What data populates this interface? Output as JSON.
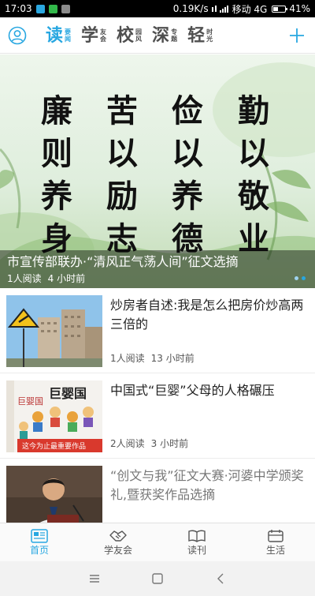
{
  "status_bar": {
    "time": "17:03",
    "network_speed": "0.19K/s",
    "carrier": "移动 4G",
    "battery": "41%"
  },
  "top_nav": {
    "tabs": [
      {
        "big": "读",
        "small": "要闻",
        "active": true
      },
      {
        "big": "学",
        "small": "友会",
        "active": false
      },
      {
        "big": "校",
        "small": "园风",
        "active": false
      },
      {
        "big": "深",
        "small": "专题",
        "active": false
      },
      {
        "big": "轻",
        "small": "时光",
        "active": false
      }
    ]
  },
  "banner": {
    "calligraphy_columns": [
      [
        "廉",
        "则",
        "养",
        "身"
      ],
      [
        "苦",
        "以",
        "励",
        "志"
      ],
      [
        "俭",
        "以",
        "养",
        "德"
      ],
      [
        "勤",
        "以",
        "敬",
        "业"
      ]
    ],
    "title": "市宣传部联办·“清风正气荡人间”征文选摘",
    "reads": "1人阅读",
    "time": "4 小时前",
    "slide_count": 2,
    "active_slide": 1
  },
  "feed": {
    "articles": [
      {
        "title": "炒房者自述:我是怎么把房价炒高两三倍的",
        "reads": "1人阅读",
        "time": "13 小时前"
      },
      {
        "title": "中国式“巨婴”父母的人格碾压",
        "reads": "2人阅读",
        "time": "3 小时前"
      },
      {
        "title": "“创文与我”征文大赛·河婆中学颁奖礼,暨获奖作品选摘",
        "reads": "",
        "time": ""
      }
    ],
    "thumb_texts": {
      "book_title": "巨婴国",
      "book_side": "巨婴国",
      "book_banner": "这今为止最重要作品"
    }
  },
  "tab_bar": {
    "tabs": [
      {
        "label": "首页",
        "icon": "home-news-icon",
        "active": true
      },
      {
        "label": "学友会",
        "icon": "handshake-icon",
        "active": false
      },
      {
        "label": "读刊",
        "icon": "open-book-icon",
        "active": false
      },
      {
        "label": "生活",
        "icon": "life-icon",
        "active": false
      }
    ]
  },
  "colors": {
    "accent": "#28a7e1",
    "status_bar_bg": "#000000",
    "tab_bar_bg": "#fafafa"
  }
}
